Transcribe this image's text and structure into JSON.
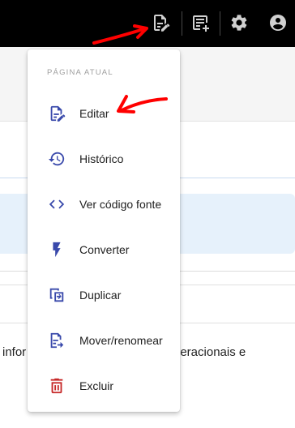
{
  "topbar": {
    "icons": [
      "edit-document-icon",
      "note-add-icon",
      "gear-icon",
      "account-icon"
    ],
    "background": "#000000"
  },
  "menu": {
    "section_header": "PÁGINA ATUAL",
    "items": [
      {
        "label": "Editar",
        "icon": "edit-document-icon"
      },
      {
        "label": "Histórico",
        "icon": "history-icon"
      },
      {
        "label": "Ver código fonte",
        "icon": "code-icon"
      },
      {
        "label": "Converter",
        "icon": "lightning-bolt-icon"
      },
      {
        "label": "Duplicar",
        "icon": "duplicate-icon"
      },
      {
        "label": "Mover/renomear",
        "icon": "move-rename-icon"
      },
      {
        "label": "Excluir",
        "icon": "trash-icon"
      }
    ],
    "icon_color": "#3949ab",
    "danger_color": "#c62828"
  },
  "background": {
    "text_left": "infor",
    "text_right": "peracionais e"
  },
  "annotation_color": "#ff0000"
}
